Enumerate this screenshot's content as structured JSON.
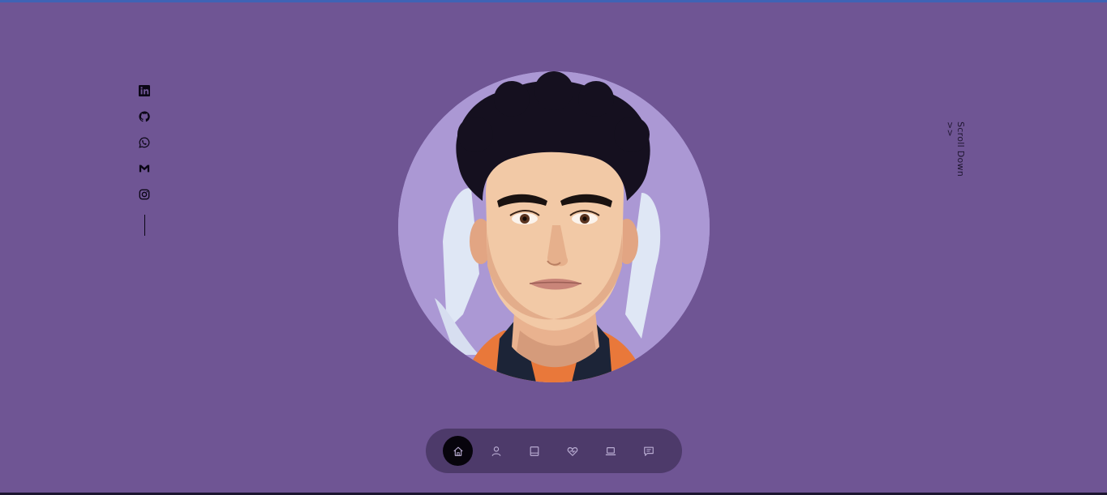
{
  "colors": {
    "background": "#6f5594",
    "navbar": "#4d3a6a",
    "nav_active": "#07040c",
    "avatar_bg": "#ab98d4"
  },
  "socials": [
    {
      "icon": "linkedin-icon"
    },
    {
      "icon": "github-icon"
    },
    {
      "icon": "whatsapp-icon"
    },
    {
      "icon": "gmail-icon"
    },
    {
      "icon": "instagram-icon"
    }
  ],
  "avatar": {
    "icon": "profile-illustration"
  },
  "scroll_down": {
    "label": "Scroll Down >>"
  },
  "nav": {
    "items": [
      {
        "icon": "home-icon",
        "active": true
      },
      {
        "icon": "user-icon",
        "active": false
      },
      {
        "icon": "book-icon",
        "active": false
      },
      {
        "icon": "heart-icon",
        "active": false
      },
      {
        "icon": "laptop-icon",
        "active": false
      },
      {
        "icon": "message-icon",
        "active": false
      }
    ]
  }
}
